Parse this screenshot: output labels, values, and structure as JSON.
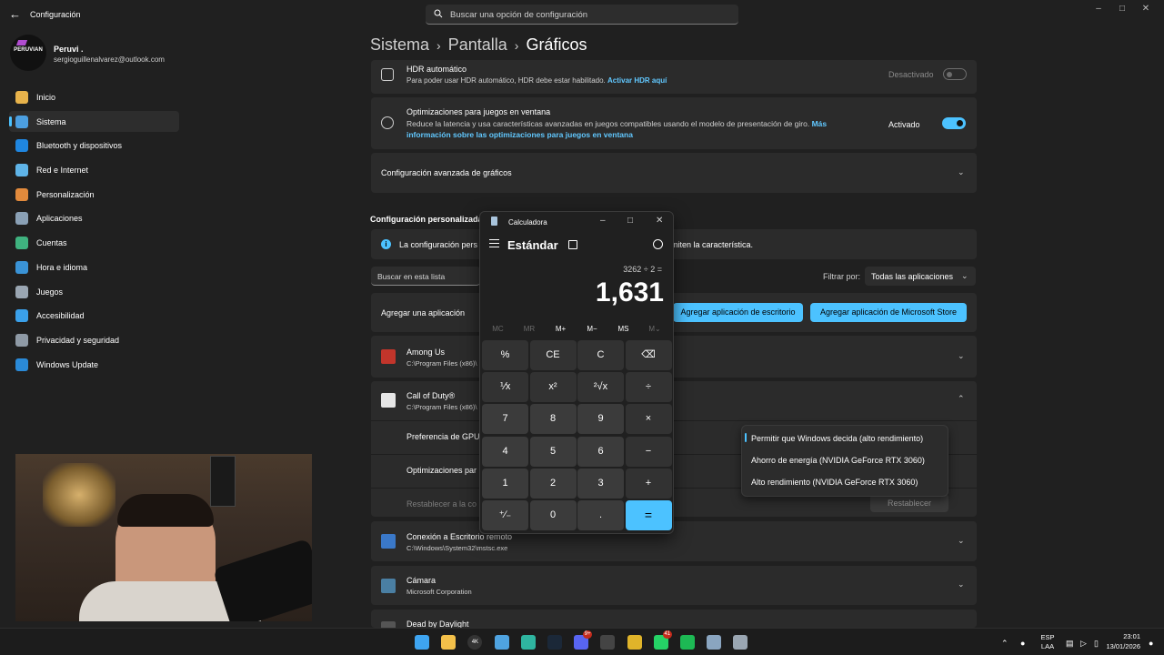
{
  "window": {
    "title": "Configuración",
    "search_placeholder": "Buscar una opción de configuración"
  },
  "profile": {
    "name": "Peruvi .",
    "email": "sergioguillenalvarez@outlook.com",
    "logo_text": "PERUVIAN"
  },
  "sidebar": {
    "items": [
      {
        "label": "Inicio",
        "icon": "home-icon",
        "color": "#e8b34b"
      },
      {
        "label": "Sistema",
        "icon": "system-icon",
        "color": "#4c9fe0"
      },
      {
        "label": "Bluetooth y dispositivos",
        "icon": "bluetooth-icon",
        "color": "#1f86e0"
      },
      {
        "label": "Red e Internet",
        "icon": "network-icon",
        "color": "#5fb4e8"
      },
      {
        "label": "Personalización",
        "icon": "brush-icon",
        "color": "#e28a3c"
      },
      {
        "label": "Aplicaciones",
        "icon": "apps-icon",
        "color": "#8aa0b5"
      },
      {
        "label": "Cuentas",
        "icon": "account-icon",
        "color": "#3fb27f"
      },
      {
        "label": "Hora e idioma",
        "icon": "globe-time-icon",
        "color": "#3a93d6"
      },
      {
        "label": "Juegos",
        "icon": "gamepad-icon",
        "color": "#9aa6b2"
      },
      {
        "label": "Accesibilidad",
        "icon": "accessibility-icon",
        "color": "#3aa0ea"
      },
      {
        "label": "Privacidad y seguridad",
        "icon": "shield-icon",
        "color": "#8f9aa6"
      },
      {
        "label": "Windows Update",
        "icon": "update-icon",
        "color": "#2a8ad8"
      }
    ]
  },
  "breadcrumb": {
    "part1": "Sistema",
    "part2": "Pantalla",
    "current": "Gráficos"
  },
  "hdr": {
    "title": "HDR automático",
    "desc": "Para poder usar HDR automático, HDR debe estar habilitado.",
    "link": "Activar HDR aquí",
    "state": "Desactivado"
  },
  "windowed": {
    "title": "Optimizaciones para juegos en ventana",
    "desc": "Reduce la latencia y usa características avanzadas en juegos compatibles usando el modelo de presentación de giro.",
    "link_1": "Más",
    "link_2": "información sobre las optimizaciones para juegos en ventana",
    "state": "Activado"
  },
  "advanced": {
    "title": "Configuración avanzada de gráficos"
  },
  "custom": {
    "section_title": "Configuración personalizada",
    "info_text_left": "La configuración pers",
    "info_text_right": "miten la característica.",
    "search_placeholder": "Buscar en esta lista",
    "filter_label": "Filtrar por:",
    "filter_value": "Todas las aplicaciones",
    "add_label": "Agregar una aplicación",
    "add_desktop": "Agregar aplicación de escritorio",
    "add_store": "Agregar aplicación de Microsoft Store"
  },
  "apps": [
    {
      "name": "Among Us",
      "path": "C:\\Program Files (x86)\\",
      "icon_color": "#c2352b"
    },
    {
      "name": "Call of Duty®",
      "path": "C:\\Program Files (x86)\\",
      "icon_color": "#e6e6e6"
    },
    {
      "name": "Conexión a Escritorio remoto",
      "path": "C:\\Windows\\System32\\mstsc.exe",
      "icon_color": "#3a78c8"
    },
    {
      "name": "Cámara",
      "path": "Microsoft Corporation",
      "icon_color": "#4a7fa3"
    },
    {
      "name": "Dead by Daylight",
      "path": "",
      "icon_color": "#555555"
    }
  ],
  "cod_settings": {
    "gpu_pref": "Preferencia de GPU",
    "opt": "Optimizaciones par",
    "reset_label": "Restablecer a la co",
    "reset_button": "Restablecer"
  },
  "gpu_dropdown": {
    "options": [
      "Permitir que Windows decida (alto rendimiento)",
      "Ahorro de energía (NVIDIA GeForce RTX 3060)",
      "Alto rendimiento (NVIDIA GeForce RTX 3060)"
    ],
    "selected_index": 0
  },
  "calculator": {
    "title": "Calculadora",
    "mode": "Estándar",
    "expression": "3262 ÷ 2 =",
    "result": "1,631",
    "memory": [
      "MC",
      "MR",
      "M+",
      "M−",
      "MS",
      "M⌄"
    ],
    "keys": [
      "%",
      "CE",
      "C",
      "⌫",
      "⅟x",
      "x²",
      "²√x",
      "÷",
      "7",
      "8",
      "9",
      "×",
      "4",
      "5",
      "6",
      "−",
      "1",
      "2",
      "3",
      "+",
      "⁺∕₋",
      "0",
      ".",
      "="
    ]
  },
  "taskbar": {
    "icons": [
      {
        "name": "start-icon",
        "color": "#3ea4f0"
      },
      {
        "name": "file-explorer-icon",
        "color": "#f3c04a"
      },
      {
        "name": "4k-app-icon",
        "color": "#333333",
        "label": "4K"
      },
      {
        "name": "photos-icon",
        "color": "#4fa3e0"
      },
      {
        "name": "edge-icon",
        "color": "#2fb5a0"
      },
      {
        "name": "steam-icon",
        "color": "#1b2838"
      },
      {
        "name": "discord-icon",
        "color": "#5865f2",
        "badge": "9+"
      },
      {
        "name": "app-red-icon",
        "color": "#444444"
      },
      {
        "name": "chrome-icon",
        "color": "#e0b42a"
      },
      {
        "name": "whatsapp-icon",
        "color": "#25d366",
        "badge": "41"
      },
      {
        "name": "spotify-icon",
        "color": "#1db954"
      },
      {
        "name": "calculator-icon",
        "color": "#8aa5c0"
      },
      {
        "name": "settings-icon",
        "color": "#9aa6b2"
      }
    ],
    "lang_1": "ESP",
    "lang_2": "LAA",
    "time": "23:01",
    "date": "13/01/2026"
  },
  "accent": "#4cc2ff"
}
